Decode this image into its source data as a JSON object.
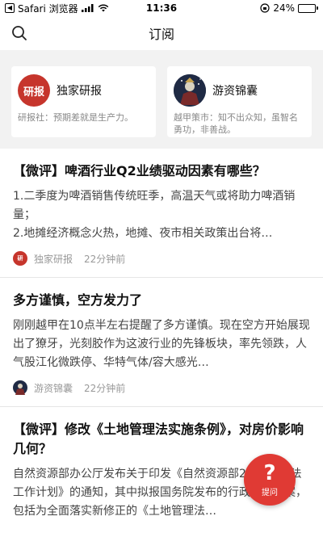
{
  "status_bar": {
    "carrier": "Safari 浏览器",
    "time": "11:36",
    "battery": "24%",
    "battery_level": 0.24
  },
  "nav": {
    "title": "订阅"
  },
  "subscriptions": [
    {
      "name": "独家研报",
      "avatar_text": "研报",
      "desc": "研报社：预期差就是生产力。"
    },
    {
      "name": "游资锦囊",
      "desc": "越甲策市：知不出众知，虽智名勇功，非善战。"
    }
  ],
  "articles": [
    {
      "title": "【微评】啤酒行业Q2业绩驱动因素有哪些？",
      "body_1": "1.二季度为啤酒销售传统旺季，高温天气或将助力啤酒销量；",
      "body_2": "2.地摊经济概念火热，地摊、夜市相关政策出台将…",
      "source": "独家研报",
      "time": "22分钟前"
    },
    {
      "title": "多方谨慎，空方发力了",
      "body_1": "刚刚越甲在10点半左右提醒了多方谨慎。现在空方开始展现出了獠牙，光刻胶作为这波行业的先锋板块，率先领跌，人气股江化微跌停、华特气体/容大感光…",
      "source": "游资锦囊",
      "time": "22分钟前"
    },
    {
      "title": "【微评】修改《土地管理法实施条例》，对房价影响几何？",
      "body_1": "自然资源部办公厅发布关于印发《自然资源部2020年立法工作计划》的通知，其中拟报国务院发布的行政法规草案，包括为全面落实新修正的《土地管理法…"
    }
  ],
  "fab": {
    "icon": "?",
    "label": "提问"
  },
  "colors": {
    "accent": "#e03a34",
    "background_gray": "#f2f2f2"
  }
}
